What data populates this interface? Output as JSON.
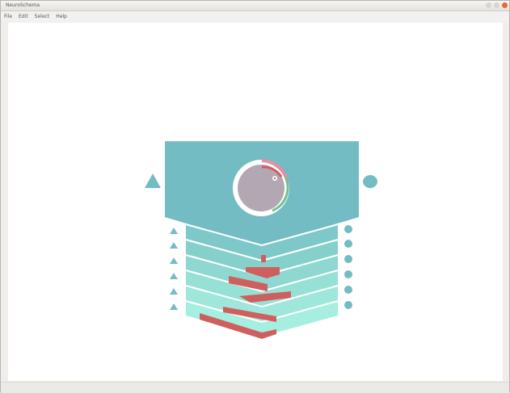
{
  "window": {
    "title": "NeuroSchema"
  },
  "menu": {
    "items": [
      "File",
      "Edit",
      "Select",
      "Help"
    ]
  },
  "colors": {
    "teal": "#73bcc4",
    "teal_light": "#a6eedf",
    "red": "#cf5f5e",
    "pink": "#e58ea6",
    "green": "#72c191",
    "gray_ball": "#b2a7b2",
    "window_close": "#e6673c"
  },
  "schema": {
    "layer_count": 6,
    "input_markers": "triangle",
    "output_markers": "circle"
  }
}
